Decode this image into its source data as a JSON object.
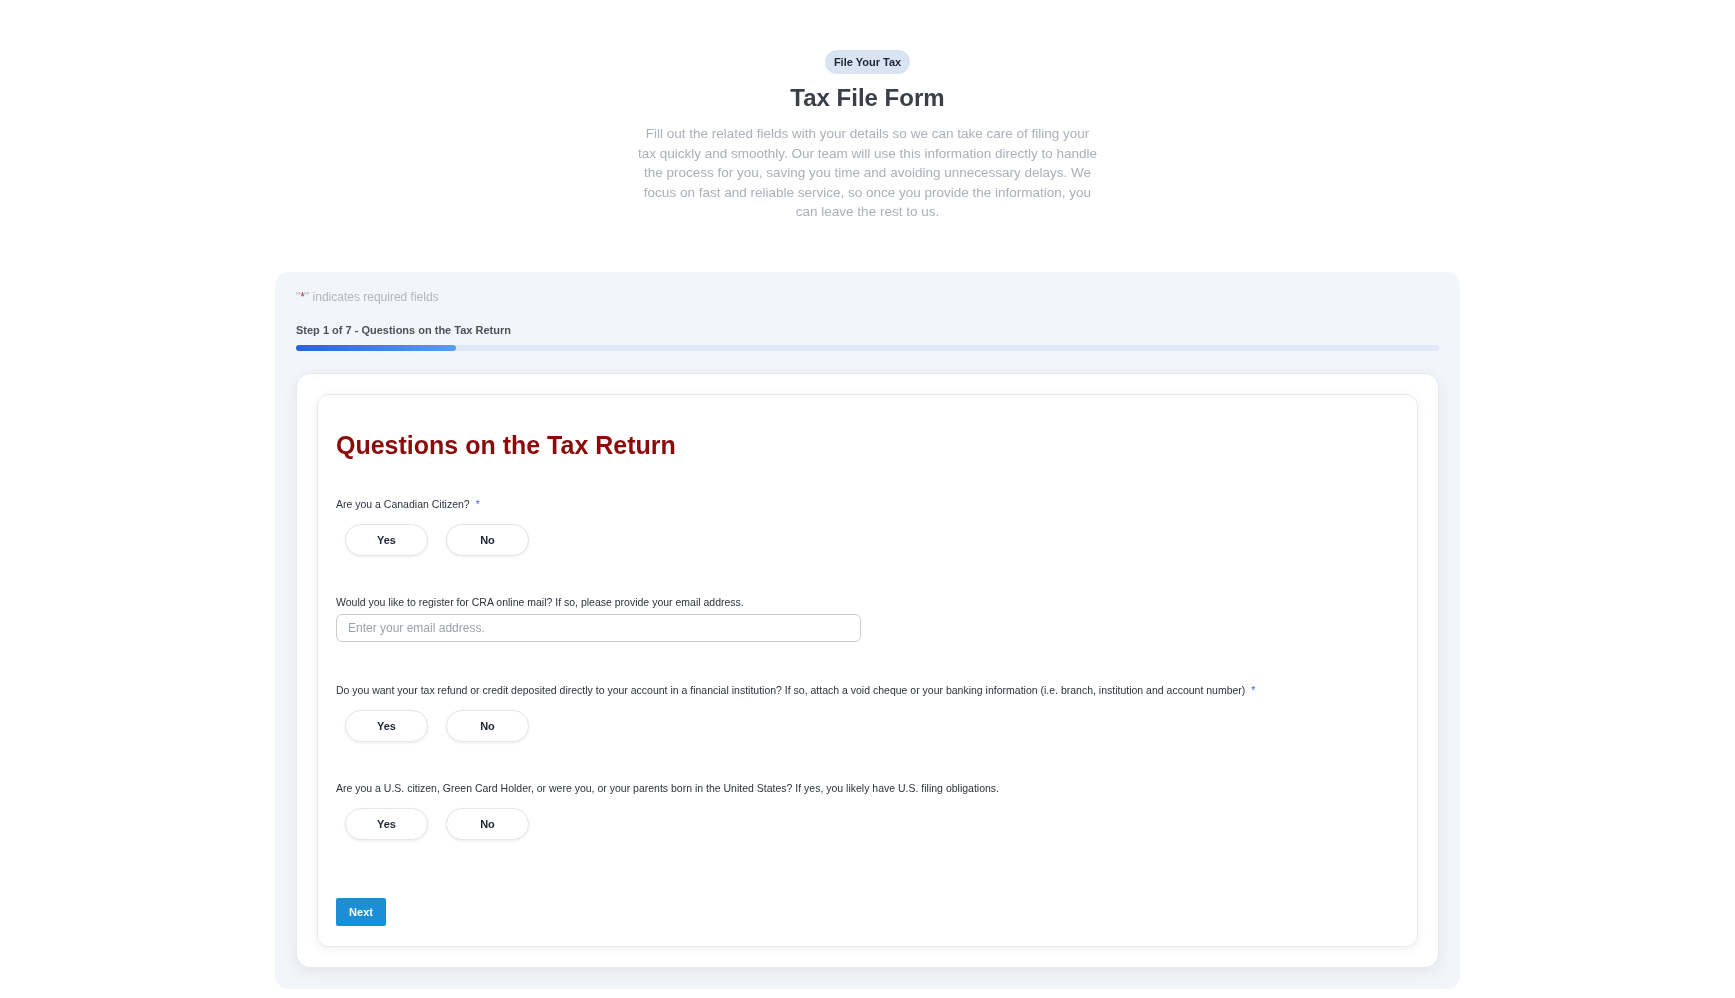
{
  "badge": "File Your Tax",
  "title": "Tax File Form",
  "intro": "Fill out the related fields with your details so we can take care of filing your tax quickly and smoothly. Our team will use this information directly to handle the process for you, saving you time and avoiding unnecessary delays. We focus on fast and reliable service, so once you provide the information, you can leave the rest to us.",
  "required_note": {
    "open_quote": "\"",
    "mark": "*",
    "close_quote": "\"",
    "text": "indicates required fields"
  },
  "step": {
    "label": "Step 1 of 7 - Questions on the Tax Return",
    "level": 0.14
  },
  "section_title": "Questions on the Tax Return",
  "questions": [
    {
      "kind": "choice",
      "label": "Are you a Canadian Citizen?",
      "required_mark": "*",
      "options": [
        {
          "label": "Yes",
          "selected": false
        },
        {
          "label": "No",
          "selected": false
        }
      ]
    },
    {
      "kind": "email",
      "label": "Would you like to register for CRA online mail? If so, please provide your email address.",
      "placeholder": "Enter your email address."
    },
    {
      "kind": "choice",
      "label": "Do you want your tax refund or credit deposited directly to your account in a financial institution? If so, attach a void cheque or your banking information (i.e. branch, institution and account number)",
      "required_mark": "*",
      "options": [
        {
          "label": "Yes",
          "selected": false
        },
        {
          "label": "No",
          "selected": false
        }
      ]
    },
    {
      "kind": "choice",
      "label": "Are you a U.S. citizen, Green Card Holder, or were you, or your parents born in the United States? If yes, you likely have U.S. filing obligations.",
      "options": [
        {
          "label": "Yes",
          "selected": false
        },
        {
          "label": "No",
          "selected": false
        }
      ]
    }
  ],
  "next_button": "Next"
}
